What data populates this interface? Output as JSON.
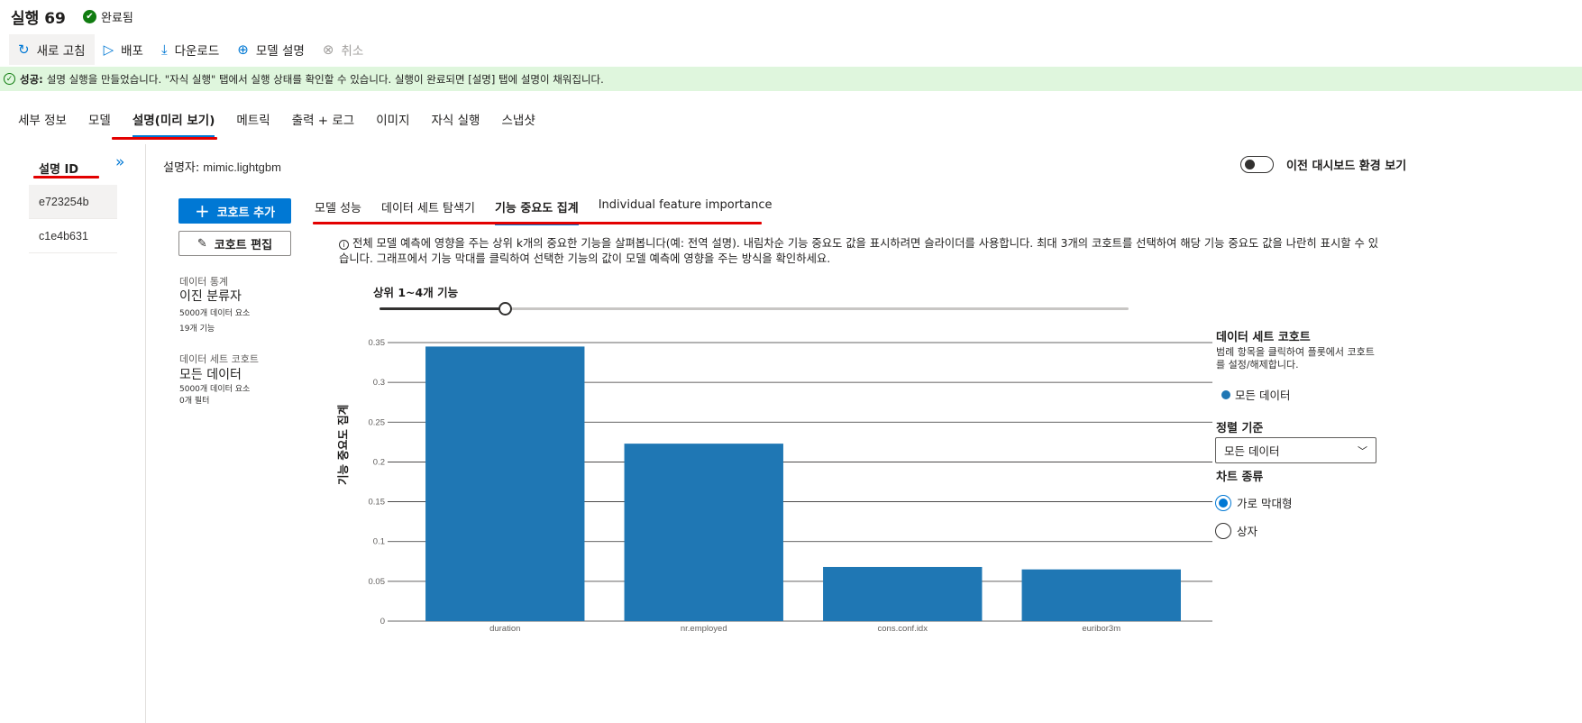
{
  "header": {
    "title": "실행 69",
    "status": "완료됨"
  },
  "toolbar": {
    "refresh": "새로 고침",
    "deploy": "배포",
    "download": "다운로드",
    "explain": "모델 설명",
    "cancel": "취소"
  },
  "banner": {
    "strong": "성공:",
    "text": "설명 실행을 만들었습니다. \"자식 실행\" 탭에서 실행 상태를 확인할 수 있습니다. 실행이 완료되면 [설명] 탭에 설명이 채워집니다."
  },
  "tabs": [
    "세부 정보",
    "모델",
    "설명(미리 보기)",
    "메트릭",
    "출력 + 로그",
    "이미지",
    "자식 실행",
    "스냅샷"
  ],
  "sidebar": {
    "header": "설명 ID",
    "items": [
      "e723254b",
      "c1e4b631"
    ]
  },
  "explainer": {
    "label": "설명자:",
    "value": "mimic.lightgbm"
  },
  "toggle_label": "이전 대시보드 환경 보기",
  "cohort": {
    "add": "코호트 추가",
    "edit": "코호트 편집",
    "data_stats_label": "데이터 통계",
    "data_stats_type": "이진 분류자",
    "data_points": "5000개 데이터 요소",
    "features": "19개 기능",
    "dataset_cohort_label": "데이터 세트 코호트",
    "dataset_cohort_name": "모든 데이터",
    "dataset_points": "5000개 데이터 요소",
    "filters": "0개 필터"
  },
  "subtabs": [
    "모델 성능",
    "데이터 세트 탐색기",
    "기능 중요도 집계",
    "Individual feature importance"
  ],
  "description": "전체 모델 예측에 영향을 주는 상위 k개의 중요한 기능을 살펴봅니다(예: 전역 설명). 내림차순 기능 중요도 값을 표시하려면 슬라이더를 사용합니다. 최대 3개의 코호트를 선택하여 해당 기능 중요도 값을 나란히 표시할 수 있습니다. 그래프에서 기능 막대를 클릭하여 선택한 기능의 값이 모델 예측에 영향을 주는 방식을 확인하세요.",
  "slider": {
    "label": "상위 1~4개 기능",
    "value": 4,
    "max": 19
  },
  "legend": {
    "title": "데이터 세트 코호트",
    "desc": "범례 항목을 클릭하여 플롯에서 코호트를 설정/해제합니다.",
    "item": "모든 데이터"
  },
  "sort": {
    "label": "정렬 기준",
    "value": "모든 데이터"
  },
  "chart_type": {
    "label": "차트 종류",
    "options": [
      "가로 막대형",
      "상자"
    ],
    "selected": 0
  },
  "colors": {
    "accent": "#0078d4",
    "bar": "#1f77b4",
    "success_bg": "#dff6dd",
    "annotation": "#e30000"
  },
  "chart_data": {
    "type": "bar",
    "categories": [
      "duration",
      "nr.employed",
      "cons.conf.idx",
      "euribor3m"
    ],
    "series": [
      {
        "name": "모든 데이터",
        "values": [
          0.345,
          0.223,
          0.068,
          0.065
        ]
      }
    ],
    "ylabel": "기능 중요도 집계",
    "xlabel": "",
    "ylim": [
      0,
      0.35
    ],
    "yticks": [
      0,
      0.05,
      0.1,
      0.15,
      0.2,
      0.25,
      0.3,
      0.35
    ],
    "grid": true
  }
}
